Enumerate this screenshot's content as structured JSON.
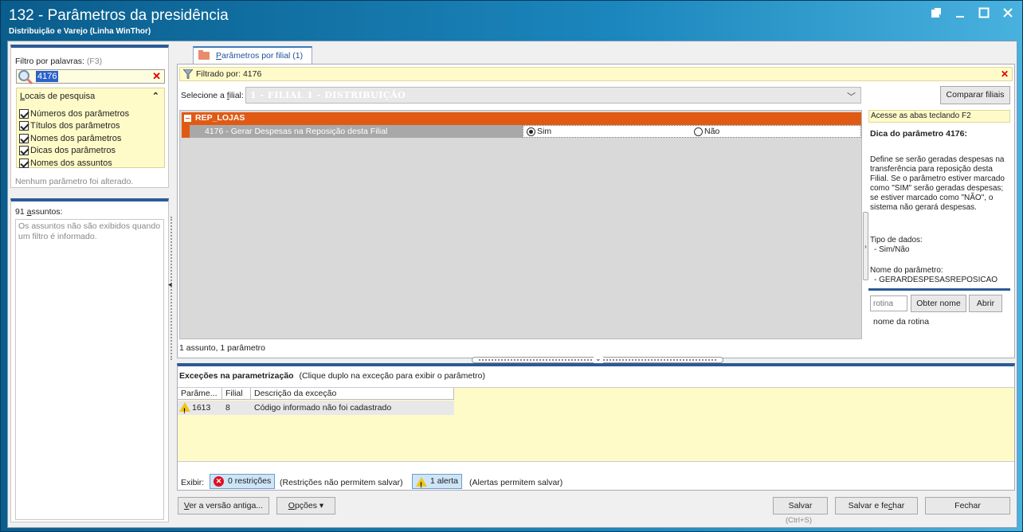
{
  "window": {
    "title": "132 - Parâmetros da presidência",
    "subtitle": "Distribuição e Varejo (Linha WinThor)"
  },
  "icons": {
    "restore": "restore-icon",
    "minimize": "minimize-icon",
    "maximize": "maximize-icon",
    "close": "close-icon"
  },
  "filter": {
    "label": "Filtro por palavras:",
    "shortcut": "(F3)",
    "value": "4176",
    "locais": {
      "title_u": "L",
      "title_rest": "ocais de pesquisa",
      "items": [
        {
          "label": "Números dos parâmetros",
          "checked": true
        },
        {
          "label": "Títulos dos parâmetros",
          "checked": true
        },
        {
          "label": "Nomes dos parâmetros",
          "checked": true
        },
        {
          "label": "Dicas dos parâmetros",
          "checked": true
        },
        {
          "label": "Nomes dos assuntos",
          "checked": true
        }
      ]
    },
    "status": "Nenhum parâmetro foi alterado."
  },
  "assuntos": {
    "count_label_pre": "91 ",
    "count_label_u": "a",
    "count_label_post": "ssuntos:",
    "message": "Os assuntos não são exibidos quando um filtro é informado."
  },
  "tab": {
    "label_u": "P",
    "label_rest": "arâmetros por filial  (1)"
  },
  "filtered_by": "Filtrado por: 4176",
  "filial": {
    "label_pre": "Selecione a ",
    "label_u": "f",
    "label_post": "ilial:",
    "value": "1 - FILIAL 1 - DISTRIBUIÇÃO"
  },
  "compare_button": "Comparar filiais",
  "grid": {
    "group": "REP_LOJAS",
    "param_label": "4176 - Gerar Despesas na Reposição desta Filial",
    "options": [
      {
        "label": "Sim",
        "selected": true
      },
      {
        "label": "Não",
        "selected": false
      }
    ]
  },
  "summary": "1 assunto, 1 parâmetro",
  "tips": {
    "hint": "Acesse as abas teclando F2",
    "title": "Dica do parâmetro 4176:",
    "text": "Define se serão geradas despesas na transferência para reposição desta Filial. Se o parâmetro estiver marcado como \"SIM\" serão geradas despesas; se estiver marcado como \"NÃO\", o sistema não gerará despesas.",
    "tipo_label": "Tipo de dados:",
    "tipo_value": "- Sim/Não",
    "nome_label": "Nome do parâmetro:",
    "nome_value": "- GERARDESPESASREPOSICAO",
    "rotina_placeholder": "rotina",
    "obter_button": "Obter nome",
    "abrir_button": "Abrir",
    "rotina_name": "nome da rotina"
  },
  "exceptions": {
    "title": "Exceções na parametrização",
    "hint": "(Clique duplo na exceção para exibir o parâmetro)",
    "columns": [
      "Parâme...",
      "Filial",
      "Descrição da exceção"
    ],
    "rows": [
      {
        "param": "1613",
        "filial": "8",
        "descricao": "Código informado não foi cadastrado"
      }
    ],
    "exibir_label": "Exibir:",
    "restricoes": "0 restrições",
    "restricoes_note": "(Restrições não permitem salvar)",
    "alertas": "1 alerta",
    "alertas_note": "(Alertas permitem salvar)"
  },
  "footer": {
    "ver_versao_u": "V",
    "ver_versao_rest": "er a versão antiga...",
    "opcoes_u": "O",
    "opcoes_rest": "pções ▾",
    "salvar": "Salvar",
    "salvar_shortcut": "(Ctrl+S)",
    "salvar_fechar_pre": "Salvar e fe",
    "salvar_fechar_u": "c",
    "salvar_fechar_post": "har",
    "fechar": "Fechar"
  }
}
